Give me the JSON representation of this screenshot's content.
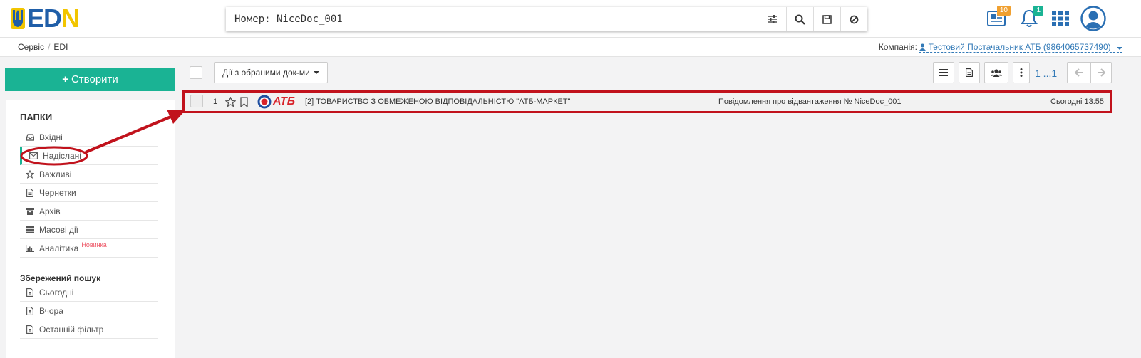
{
  "header": {
    "logo_text": [
      "E",
      "D",
      "N"
    ],
    "search_value": "Номер: NiceDoc_001",
    "search_buttons": [
      "filter-icon",
      "search-icon",
      "save-icon",
      "clear-icon"
    ],
    "news_count": "10",
    "notifications_count": "1"
  },
  "breadcrumb": {
    "items": [
      "Сервіс",
      "EDI"
    ],
    "company_label": "Компанія:",
    "company_name": "Тестовий Постачальник АТБ (9864065737490)"
  },
  "sidebar": {
    "create_label": "Створити",
    "folders_title": "ПАПКИ",
    "folders": [
      {
        "label": "Вхідні",
        "icon": "inbox-icon"
      },
      {
        "label": "Надіслані",
        "icon": "envelope-icon"
      },
      {
        "label": "Важливі",
        "icon": "star-icon"
      },
      {
        "label": "Чернетки",
        "icon": "draft-icon"
      },
      {
        "label": "Архів",
        "icon": "archive-icon"
      },
      {
        "label": "Масові дії",
        "icon": "bulk-icon"
      },
      {
        "label": "Аналітика",
        "icon": "chart-icon",
        "badge": "Новинка"
      }
    ],
    "saved_title": "Збережений пошук",
    "saved": [
      {
        "label": "Сьогодні"
      },
      {
        "label": "Вчора"
      },
      {
        "label": "Останній фільтр"
      }
    ]
  },
  "toolbar": {
    "actions_label": "Дії з обраними док-ми",
    "pager": "1 ...1"
  },
  "documents": [
    {
      "number": "1",
      "partner_logo": "АТБ",
      "partner": "[2] ТОВАРИСТВО З ОБМЕЖЕНОЮ ВІДПОВІДАЛЬНІСТЮ \"АТБ-МАРКЕТ\"",
      "title": "Повідомлення про відвантаження № NiceDoc_001",
      "date": "Сьогодні 13:55"
    }
  ],
  "colors": {
    "accent": "#1ab394",
    "annotation": "#c1121c",
    "link": "#337ab7"
  }
}
